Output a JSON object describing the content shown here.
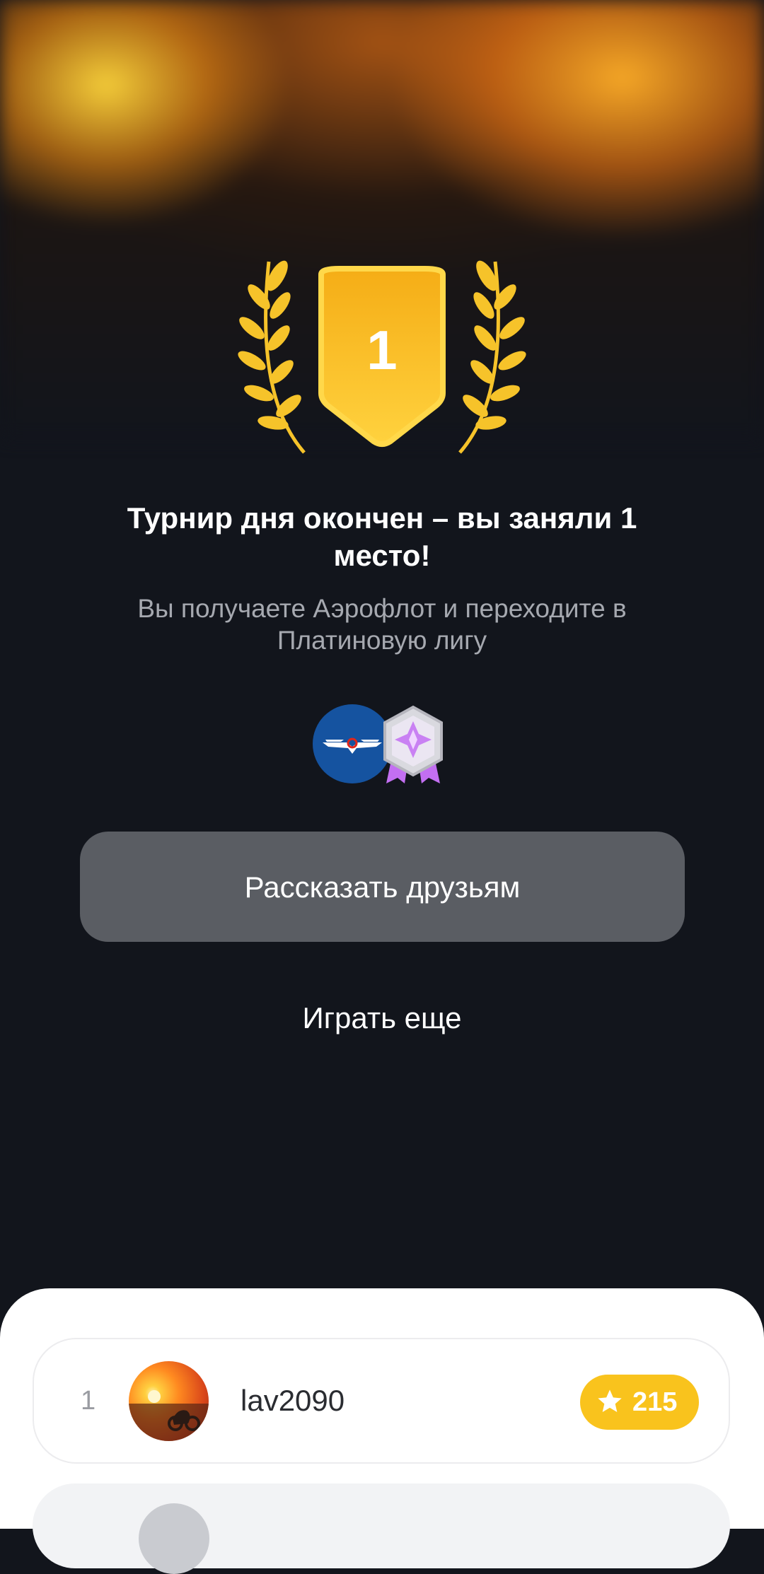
{
  "result": {
    "place": "1",
    "title": "Турнир дня окончен – вы заняли 1 место!",
    "subtitle": "Вы получаете Аэрофлот и переходите в Платиновую лигу"
  },
  "rewards": [
    {
      "icon": "aeroflot-logo-icon",
      "color": "#1553a0"
    },
    {
      "icon": "platinum-league-badge-icon",
      "color": "#c77dff"
    }
  ],
  "actions": {
    "share_label": "Рассказать друзьям",
    "play_again_label": "Играть еще"
  },
  "leaderboard": [
    {
      "rank": "1",
      "username": "lav2090",
      "score": "215",
      "score_icon": "star-icon"
    }
  ],
  "colors": {
    "accent_gold": "#f9c31d",
    "background": "#12151c",
    "share_button": "#5a5d63"
  }
}
